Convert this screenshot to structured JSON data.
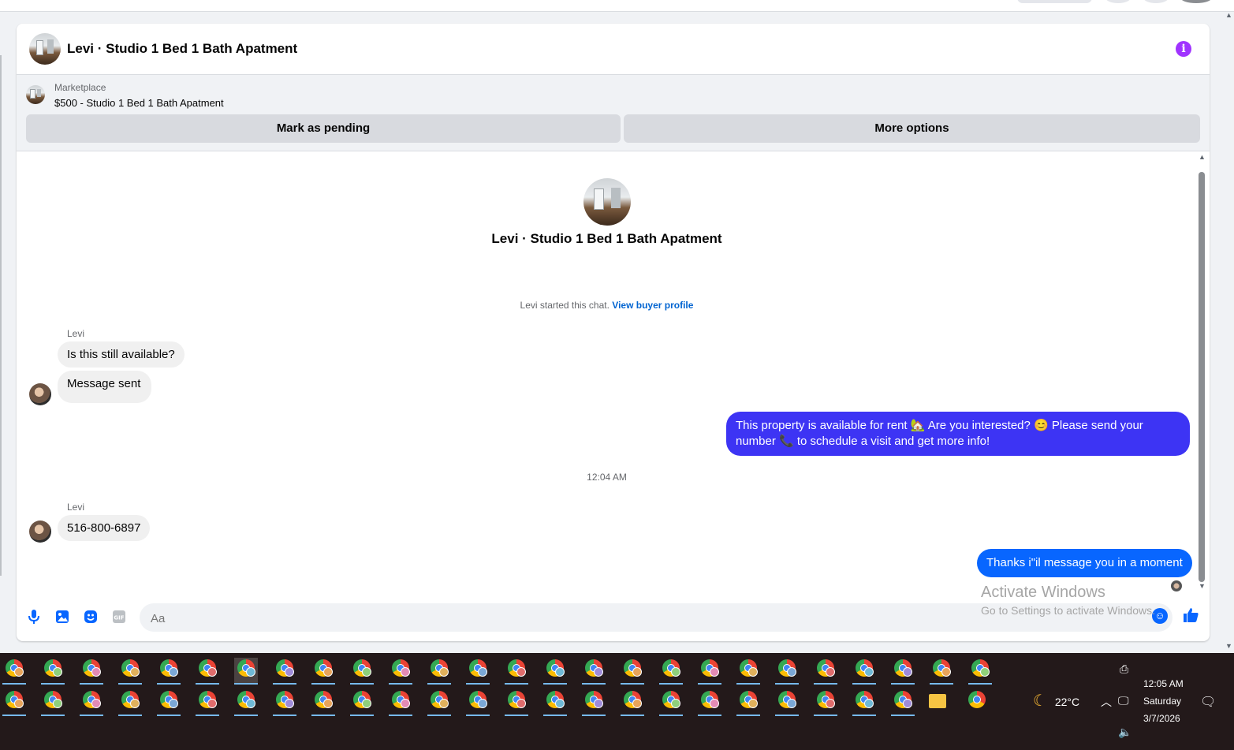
{
  "conversation": {
    "header_title": "Levi · Studio 1 Bed 1 Bath Apatment",
    "center_title": "Levi · Studio 1 Bed 1 Bath Apatment"
  },
  "marketplace": {
    "label": "Marketplace",
    "item": "$500 - Studio 1 Bed 1 Bath Apatment",
    "mark_pending": "Mark as pending",
    "more_options": "More options"
  },
  "chat": {
    "started_text": "Levi started this chat.",
    "view_profile": "View buyer profile",
    "messages": [
      {
        "sender": "Levi",
        "text": "Is this still available?"
      },
      {
        "text": "Message sent"
      },
      {
        "text": "This property is available for rent 🏡 Are you interested? 😊 Please send your number 📞 to schedule a visit and get more info!"
      },
      {
        "time": "12:04 AM"
      },
      {
        "sender": "Levi",
        "text": "516-800-6897"
      },
      {
        "text": "Thanks i\"il message you in a moment"
      }
    ],
    "out_color_1": "#3d34f4",
    "out_color_2": "#0866ff"
  },
  "composer": {
    "placeholder": "Aa",
    "icons": [
      "microphone-icon",
      "photo-icon",
      "sticker-icon",
      "gif-icon",
      "emoji-icon",
      "thumbs-up-icon"
    ]
  },
  "watermark": {
    "line1": "Activate Windows",
    "line2": "Go to Settings to activate Windows."
  },
  "taskbar": {
    "weather_temp": "22°C",
    "time": "12:05 AM",
    "day": "Saturday",
    "date": "3/7/2026"
  }
}
